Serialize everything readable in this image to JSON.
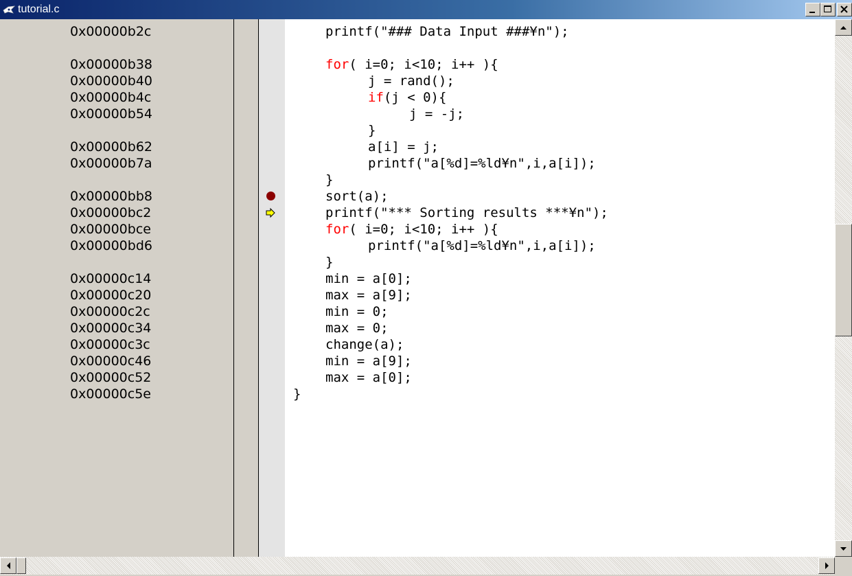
{
  "window": {
    "title": "tutorial.c"
  },
  "title_buttons": [
    "minimize-icon",
    "maximize-icon",
    "close-icon"
  ],
  "colors": {
    "keyword": "#ff0000",
    "breakpoint": "#8b0000",
    "current_line_arrow": "#ffff00",
    "title_gradient_start": "#0a246a"
  },
  "lines": [
    {
      "addr": "0x00000b2c",
      "indent": 1,
      "parts": [
        {
          "t": "printf(\"### Data Input ###¥n\");"
        }
      ]
    },
    {
      "addr": "",
      "indent": 0,
      "parts": []
    },
    {
      "addr": "0x00000b38",
      "indent": 1,
      "parts": [
        {
          "t": "for",
          "kw": true
        },
        {
          "t": "( i=0; i<10; i++ ){"
        }
      ]
    },
    {
      "addr": "0x00000b40",
      "indent": 2,
      "parts": [
        {
          "t": "j = rand();"
        }
      ]
    },
    {
      "addr": "0x00000b4c",
      "indent": 2,
      "parts": [
        {
          "t": "if",
          "kw": true
        },
        {
          "t": "(j < 0){"
        }
      ]
    },
    {
      "addr": "0x00000b54",
      "indent": 3,
      "parts": [
        {
          "t": "j = -j;"
        }
      ]
    },
    {
      "addr": "",
      "indent": 2,
      "parts": [
        {
          "t": "}"
        }
      ]
    },
    {
      "addr": "0x00000b62",
      "indent": 2,
      "parts": [
        {
          "t": "a[i] = j;"
        }
      ]
    },
    {
      "addr": "0x00000b7a",
      "indent": 2,
      "parts": [
        {
          "t": "printf(\"a[%d]=%ld¥n\",i,a[i]);"
        }
      ]
    },
    {
      "addr": "",
      "indent": 1,
      "parts": [
        {
          "t": "}"
        }
      ]
    },
    {
      "addr": "0x00000bb8",
      "indent": 1,
      "parts": [
        {
          "t": "sort(a);"
        }
      ],
      "breakpoint": true
    },
    {
      "addr": "0x00000bc2",
      "indent": 1,
      "parts": [
        {
          "t": "printf(\"*** Sorting results ***¥n\");"
        }
      ],
      "current": true
    },
    {
      "addr": "0x00000bce",
      "indent": 1,
      "parts": [
        {
          "t": "for",
          "kw": true
        },
        {
          "t": "( i=0; i<10; i++ ){"
        }
      ]
    },
    {
      "addr": "0x00000bd6",
      "indent": 2,
      "parts": [
        {
          "t": "printf(\"a[%d]=%ld¥n\",i,a[i]);"
        }
      ]
    },
    {
      "addr": "",
      "indent": 1,
      "parts": [
        {
          "t": "}"
        }
      ]
    },
    {
      "addr": "0x00000c14",
      "indent": 1,
      "parts": [
        {
          "t": "min = a[0];"
        }
      ]
    },
    {
      "addr": "0x00000c20",
      "indent": 1,
      "parts": [
        {
          "t": "max = a[9];"
        }
      ]
    },
    {
      "addr": "0x00000c2c",
      "indent": 1,
      "parts": [
        {
          "t": "min = 0;"
        }
      ]
    },
    {
      "addr": "0x00000c34",
      "indent": 1,
      "parts": [
        {
          "t": "max = 0;"
        }
      ]
    },
    {
      "addr": "0x00000c3c",
      "indent": 1,
      "parts": [
        {
          "t": "change(a);"
        }
      ]
    },
    {
      "addr": "0x00000c46",
      "indent": 1,
      "parts": [
        {
          "t": "min = a[9];"
        }
      ]
    },
    {
      "addr": "0x00000c52",
      "indent": 1,
      "parts": [
        {
          "t": "max = a[0];"
        }
      ]
    },
    {
      "addr": "0x00000c5e",
      "indent": 0,
      "parts": [
        {
          "t": "}"
        }
      ]
    }
  ]
}
